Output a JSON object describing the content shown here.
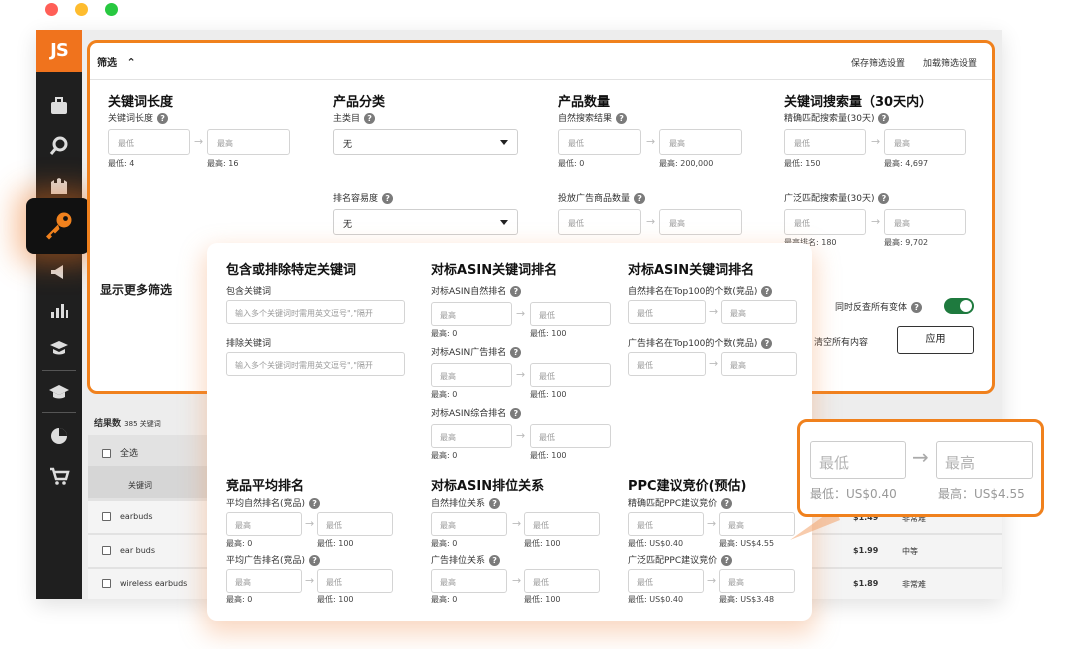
{
  "colors": {
    "accent": "#f0731d",
    "toggle": "#1e7a3e",
    "mac_red": "#ff5f57",
    "mac_yellow": "#febc2e",
    "mac_green": "#28c840"
  },
  "app": {
    "logo": "JS"
  },
  "sidebar": {
    "icons": [
      "briefcase-icon",
      "search-icon",
      "castle-icon",
      "key-icon",
      "megaphone-icon",
      "bar-chart-icon",
      "graduation-hand-icon",
      "graduation-cap-icon",
      "pie-chart-icon",
      "cart-icon"
    ],
    "active": "key-icon"
  },
  "filter": {
    "title": "筛选",
    "save": "保存筛选设置",
    "load": "加载筛选设置",
    "keyword_length": {
      "heading": "关键词长度",
      "label": "关键词长度",
      "min_ph": "最低",
      "max_ph": "最高",
      "min_val": "最低: 4",
      "max_val": "最高: 16"
    },
    "category": {
      "heading": "产品分类",
      "label": "主类目",
      "value": "无",
      "rank_label": "排名容易度",
      "rank_value": "无"
    },
    "product_count": {
      "heading": "产品数量",
      "label": "自然搜索结果",
      "min_ph": "最低",
      "max_ph": "最高",
      "min_val": "最低: 0",
      "max_val": "最高: 200,000",
      "ads_label": "投放广告商品数量",
      "ads_min_ph": "最低",
      "ads_max_ph": "最高"
    },
    "search_volume": {
      "heading": "关键词搜索量（30天内）",
      "exact_label": "精确匹配搜索量(30天)",
      "min_ph": "最低",
      "max_ph": "最高",
      "min_val": "最低: 150",
      "max_val": "最高: 4,697",
      "broad_label": "广泛匹配搜索量(30天)",
      "broad_min_val": "最高排名: 180",
      "broad_max_val": "最高: 9,702"
    },
    "show_more": "显示更多筛选",
    "variants": "同时反查所有变体",
    "clear": "清空所有内容",
    "apply": "应用"
  },
  "popup": {
    "include": {
      "heading": "包含或排除特定关键词",
      "inc_label": "包含关键词",
      "inc_ph": "输入多个关键词时需用英文逗号\",\"隔开",
      "exc_label": "排除关键词",
      "exc_ph": "输入多个关键词时需用英文逗号\",\"隔开"
    },
    "asin_rank": {
      "heading": "对标ASIN关键词排名",
      "organic": "对标ASIN自然排名",
      "ad": "对标ASIN广告排名",
      "combined": "对标ASIN综合排名",
      "hi_ph": "最高",
      "lo_ph": "最低",
      "hi_val": "最高: 0",
      "lo_val": "最低: 100"
    },
    "asin_rank2": {
      "heading": "对标ASIN关键词排名",
      "organic": "自然排名在Top100的个数(竞品)",
      "ad": "广告排名在Top100的个数(竞品)",
      "lo_ph": "最低",
      "hi_ph": "最高"
    },
    "avg_rank": {
      "heading": "竞品平均排名",
      "organic": "平均自然排名(竞品)",
      "ad": "平均广告排名(竞品)",
      "hi_ph": "最高",
      "lo_ph": "最低",
      "hi_val": "最高: 0",
      "lo_val": "最低: 100"
    },
    "asin_rel": {
      "heading": "对标ASIN排位关系",
      "organic": "自然排位关系",
      "ad": "广告排位关系",
      "hi_ph": "最高",
      "lo_ph": "最低",
      "hi_val": "最高: 0",
      "lo_val": "最低: 100"
    },
    "ppc": {
      "heading": "PPC建议竞价(预估)",
      "exact": "精确匹配PPC建议竞价",
      "broad": "广泛匹配PPC建议竞价",
      "lo_ph": "最低",
      "hi_ph": "最高",
      "exact_lo": "最低: US$0.40",
      "exact_hi": "最高: US$4.55",
      "broad_lo": "最低: US$0.40",
      "broad_hi": "最高: US$3.48"
    }
  },
  "results": {
    "count_label": "结果数",
    "count": "385 关键词",
    "select_all": "全选",
    "col_keyword": "关键词",
    "rows": [
      {
        "keyword": "earbuds",
        "price": "$1.49",
        "diff": "非常难"
      },
      {
        "keyword": "ear buds",
        "price": "$1.99",
        "diff": "中等"
      },
      {
        "keyword": "wireless earbuds",
        "price": "$1.89",
        "diff": "非常难"
      }
    ]
  },
  "zoom": {
    "min_ph": "最低",
    "max_ph": "最高",
    "min_val": "最低：US$0.40",
    "max_val": "最高：US$4.55"
  }
}
